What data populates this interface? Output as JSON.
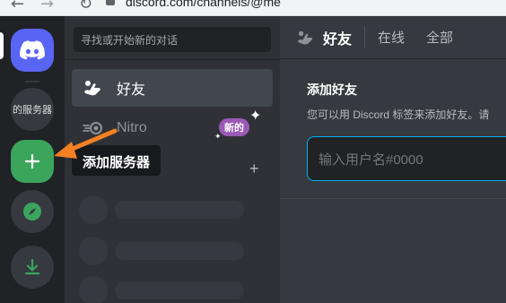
{
  "browser": {
    "url": "discord.com/channels/@me"
  },
  "rail": {
    "server_name": "的服务器",
    "add_server_tooltip": "添加服务器"
  },
  "channels": {
    "search_placeholder": "寻找或开始新的对话",
    "friends_label": "好友",
    "nitro_label": "Nitro",
    "new_badge": "新的"
  },
  "header": {
    "title": "好友",
    "tabs": [
      "在线",
      "全部"
    ]
  },
  "add_friend": {
    "title": "添加好友",
    "description": "您可以用 Discord 标签来添加好友。请",
    "input_placeholder": "输入用户名#0000"
  },
  "colors": {
    "blurple": "#5865f2",
    "green": "#3ba55c",
    "arrow": "#f48024",
    "focus": "#00b0f4"
  }
}
